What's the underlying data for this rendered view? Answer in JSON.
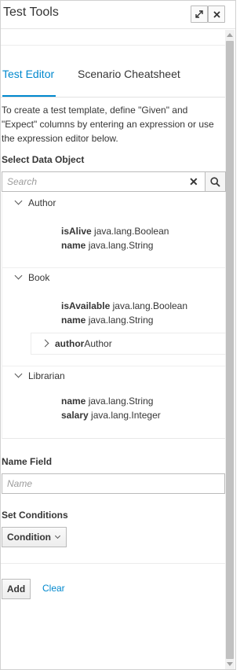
{
  "header": {
    "title": "Test Tools"
  },
  "tabs": [
    {
      "label": "Test Editor",
      "active": true
    },
    {
      "label": "Scenario Cheatsheet",
      "active": false
    }
  ],
  "description": "To create a test template, define \"Given\" and \"Expect\" columns by entering an expression or use the expression editor below.",
  "data_object": {
    "label": "Select Data Object",
    "search_placeholder": "Search",
    "groups": [
      {
        "name": "Author",
        "fields": [
          {
            "name": "isAlive",
            "type": "java.lang.Boolean"
          },
          {
            "name": "name",
            "type": "java.lang.String"
          }
        ]
      },
      {
        "name": "Book",
        "fields": [
          {
            "name": "isAvailable",
            "type": "java.lang.Boolean"
          },
          {
            "name": "name",
            "type": "java.lang.String"
          }
        ],
        "nested": {
          "name": "author",
          "type": "Author"
        }
      },
      {
        "name": "Librarian",
        "fields": [
          {
            "name": "name",
            "type": "java.lang.String"
          },
          {
            "name": "salary",
            "type": "java.lang.Integer"
          }
        ]
      }
    ]
  },
  "name_field": {
    "label": "Name Field",
    "placeholder": "Name"
  },
  "conditions": {
    "label": "Set Conditions",
    "selected": "Condition"
  },
  "actions": {
    "add": "Add",
    "clear": "Clear"
  },
  "colors": {
    "accent": "#0088ce",
    "text": "#363636"
  }
}
